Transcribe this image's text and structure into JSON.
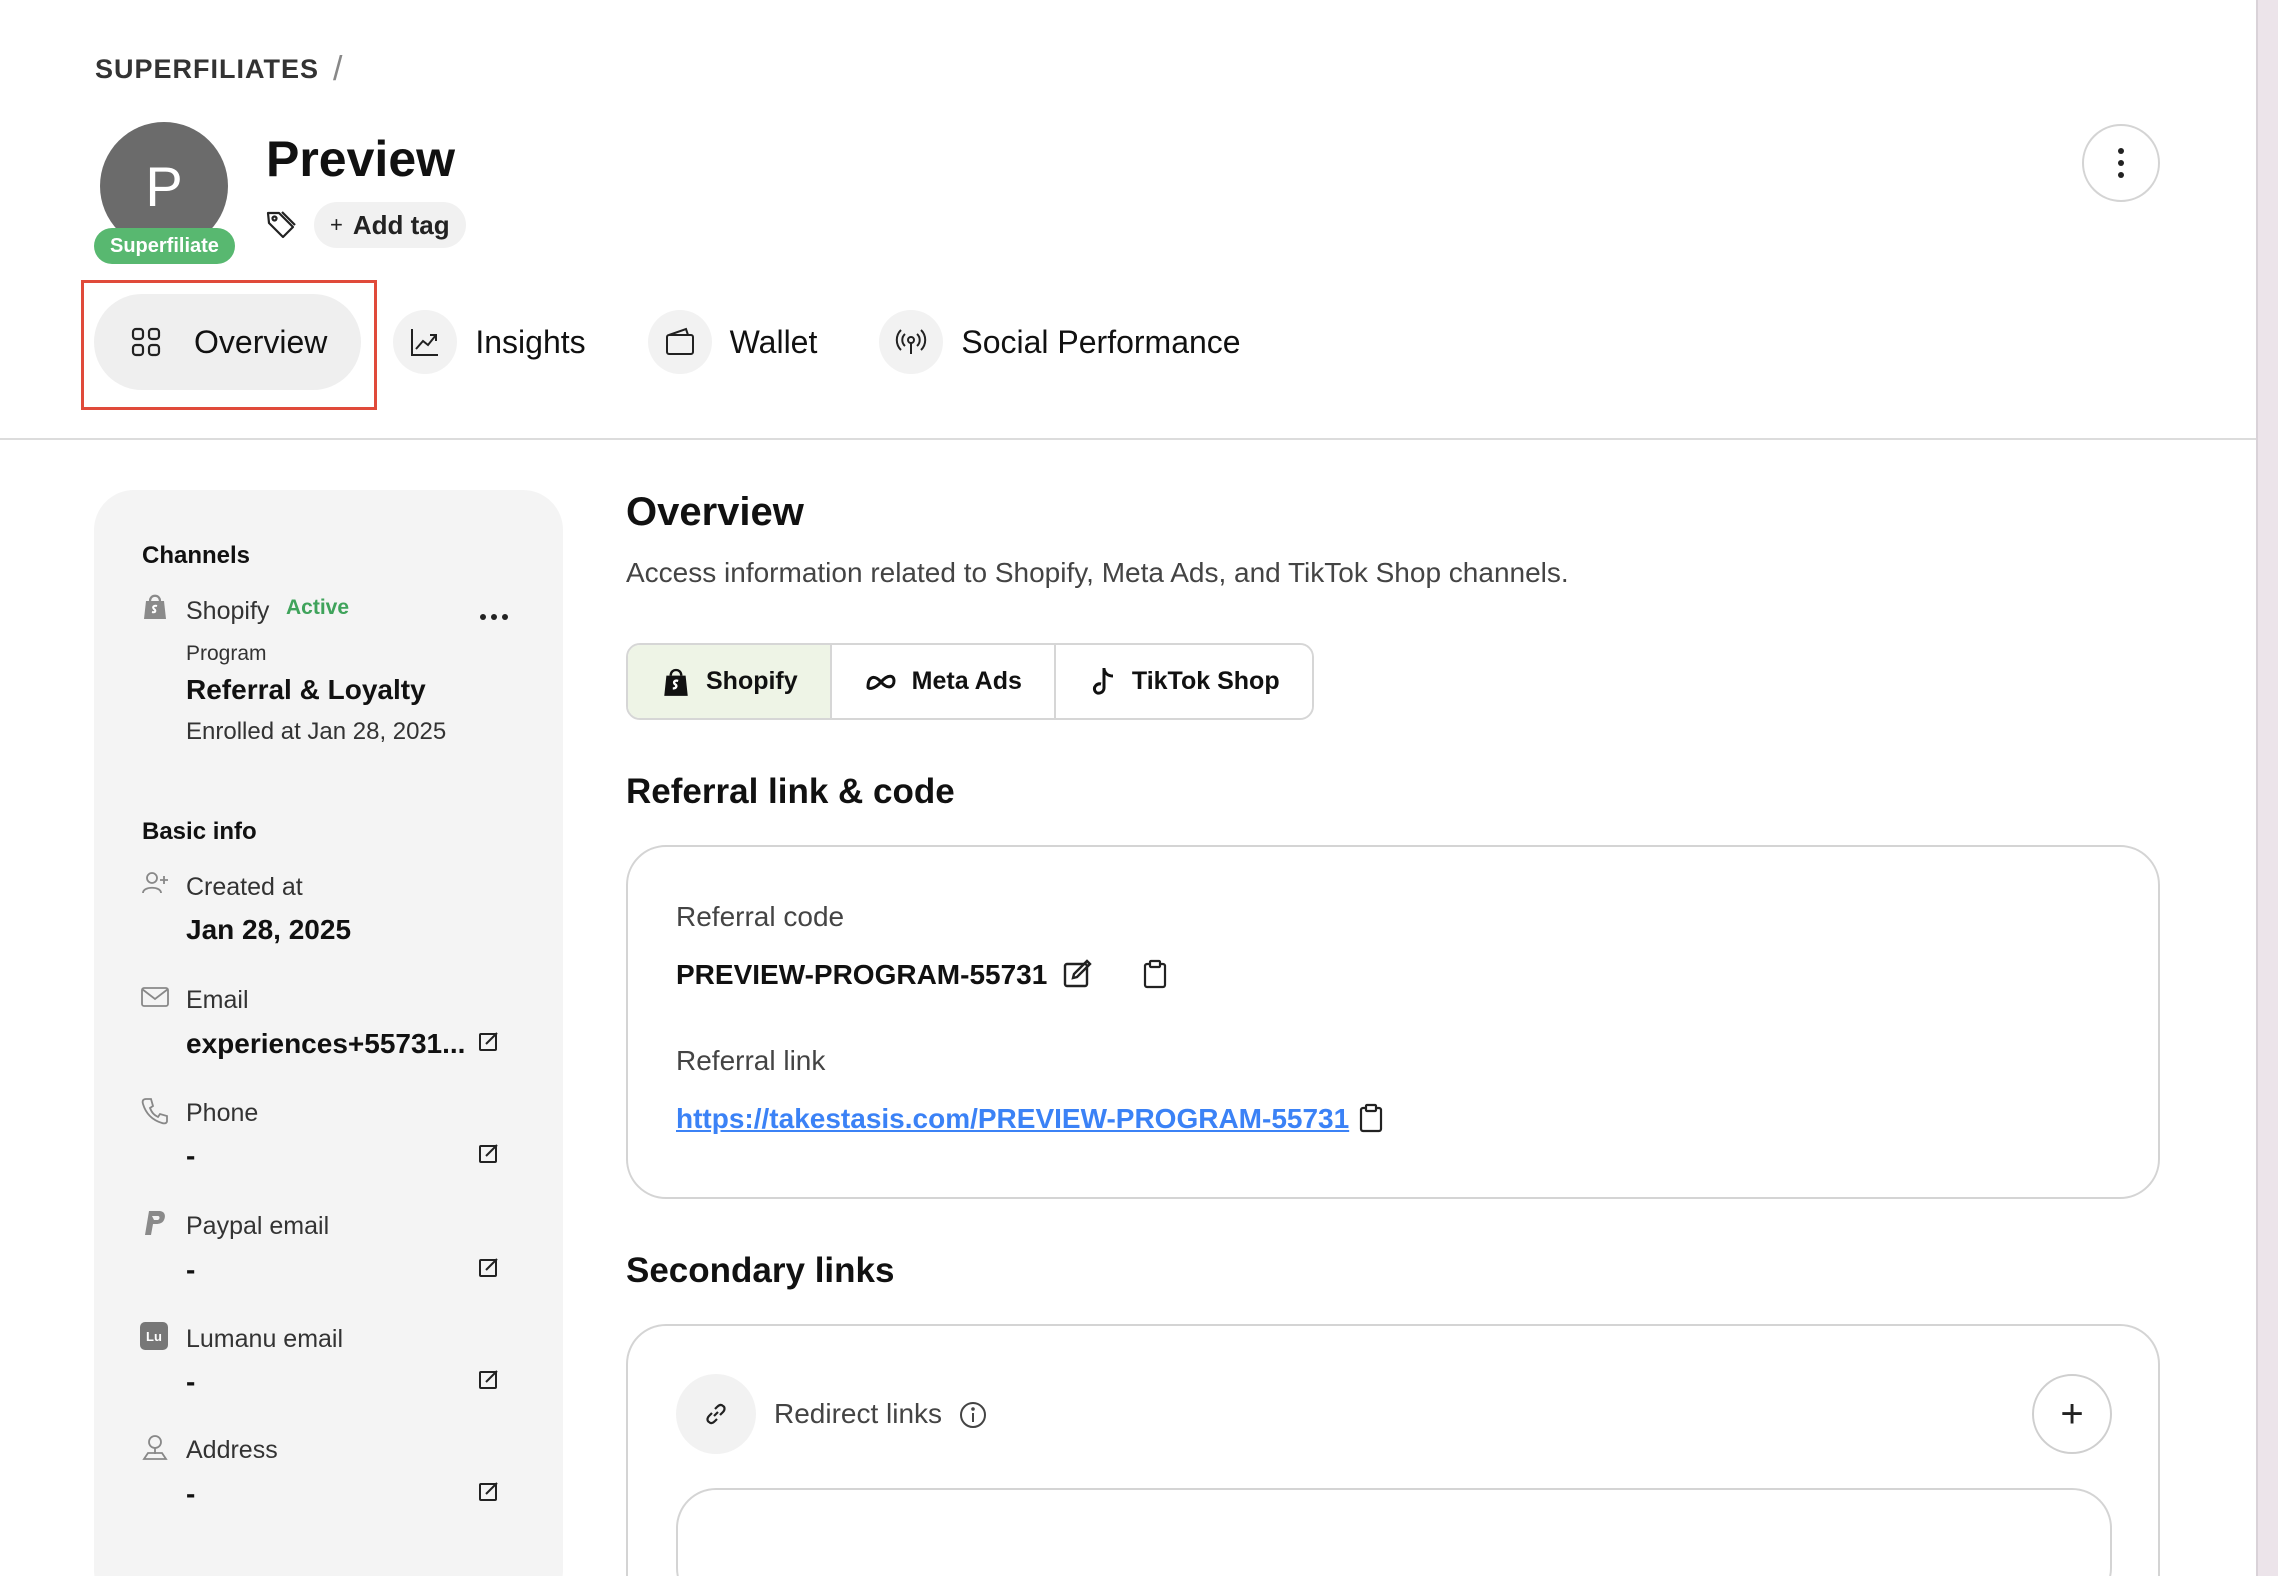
{
  "breadcrumb": {
    "root": "SUPERFILIATES",
    "separator": "/"
  },
  "profile": {
    "avatar_initial": "P",
    "badge": "Superfiliate",
    "name": "Preview",
    "add_tag_label": "Add tag",
    "add_tag_plus": "+"
  },
  "tabs": [
    {
      "label": "Overview",
      "icon": "grid-icon",
      "active": true
    },
    {
      "label": "Insights",
      "icon": "chart-line-icon",
      "active": false
    },
    {
      "label": "Wallet",
      "icon": "wallet-icon",
      "active": false
    },
    {
      "label": "Social Performance",
      "icon": "broadcast-icon",
      "active": false
    }
  ],
  "sidebar": {
    "channels_heading": "Channels",
    "channel": {
      "name": "Shopify",
      "status": "Active",
      "program_label": "Program",
      "program_name": "Referral & Loyalty",
      "enrolled": "Enrolled at Jan 28, 2025"
    },
    "basic_info_heading": "Basic info",
    "fields": [
      {
        "label": "Created at",
        "value": "Jan 28, 2025",
        "icon": "user-plus-icon"
      },
      {
        "label": "Email",
        "value": "experiences+55731...",
        "icon": "mail-icon"
      },
      {
        "label": "Phone",
        "value": "-",
        "icon": "phone-icon"
      },
      {
        "label": "Paypal email",
        "value": "-",
        "icon": "paypal-icon"
      },
      {
        "label": "Lumanu email",
        "value": "-",
        "icon": "lumanu-icon",
        "icon_text": "Lu"
      },
      {
        "label": "Address",
        "value": "-",
        "icon": "address-icon"
      }
    ]
  },
  "main": {
    "title": "Overview",
    "description": "Access information related to Shopify, Meta Ads, and TikTok Shop channels.",
    "channel_tabs": [
      {
        "label": "Shopify",
        "icon": "shopify-icon",
        "active": true
      },
      {
        "label": "Meta Ads",
        "icon": "meta-icon",
        "active": false
      },
      {
        "label": "TikTok Shop",
        "icon": "tiktok-icon",
        "active": false
      }
    ],
    "referral_section_title": "Referral link & code",
    "referral_code_label": "Referral code",
    "referral_code": "PREVIEW-PROGRAM-55731",
    "referral_link_label": "Referral link",
    "referral_link": "https://takestasis.com/PREVIEW-PROGRAM-55731",
    "secondary_section_title": "Secondary links",
    "redirect_links_label": "Redirect links",
    "add_button": "+"
  },
  "colors": {
    "badge_green": "#58b870",
    "active_green": "#3fa35b",
    "link_blue": "#3b82f6",
    "highlight_red": "#e04a3a"
  }
}
